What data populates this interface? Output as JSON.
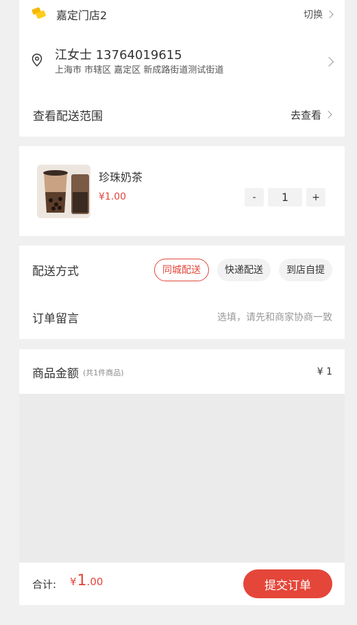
{
  "store": {
    "name": "嘉定门店2",
    "switch_label": "切换"
  },
  "address": {
    "name_phone": "江女士 13764019615",
    "detail": "上海市 市辖区 嘉定区 新成路街道测试街道"
  },
  "delivery_range": {
    "label": "查看配送范围",
    "link": "去查看"
  },
  "product": {
    "name": "珍珠奶茶",
    "price": "¥1.00",
    "quantity": "1",
    "minus": "-",
    "plus": "+"
  },
  "delivery": {
    "label": "配送方式",
    "options": [
      "同城配送",
      "快递配送",
      "到店自提"
    ],
    "selected": "同城配送"
  },
  "note": {
    "label": "订单留言",
    "placeholder": "选填，请先和商家协商一致"
  },
  "amount": {
    "label": "商品金额",
    "count": "(共1件商品)",
    "value": "¥ 1"
  },
  "footer": {
    "total_label": "合计:",
    "currency": "¥",
    "total_int": "1",
    "total_dec": ".00",
    "submit": "提交订单"
  },
  "colors": {
    "accent": "#e4463a",
    "background": "#f0f0f0"
  }
}
